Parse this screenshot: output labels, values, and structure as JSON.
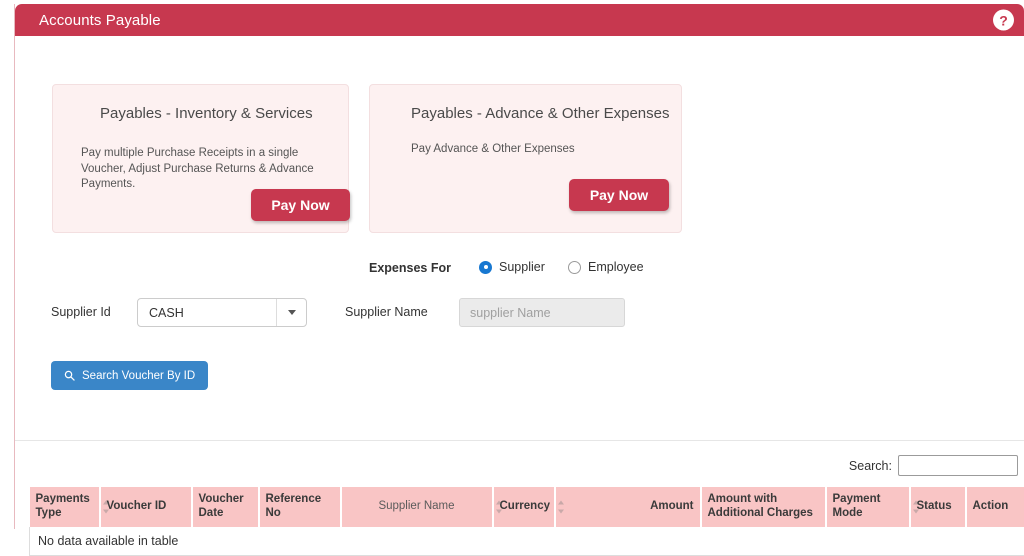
{
  "header": {
    "title": "Accounts Payable",
    "help_icon": "question-mark-icon",
    "help_label": "?",
    "bg_color": "#c7384f"
  },
  "cards": [
    {
      "title": "Payables - Inventory & Services",
      "description": "Pay multiple Purchase Receipts in a single Voucher, Adjust Purchase Returns & Advance Payments.",
      "button_label": "Pay Now"
    },
    {
      "title": "Payables - Advance & Other Expenses",
      "description": "Pay Advance & Other Expenses",
      "button_label": "Pay Now"
    }
  ],
  "form": {
    "expenses_for_label": "Expenses For",
    "radios": [
      {
        "label": "Supplier",
        "selected": true
      },
      {
        "label": "Employee",
        "selected": false
      }
    ],
    "supplier_id_label": "Supplier Id",
    "supplier_id_value": "CASH",
    "supplier_name_label": "Supplier Name",
    "supplier_name_value": "",
    "supplier_name_placeholder": "supplier Name",
    "search_voucher_button": "Search Voucher By ID"
  },
  "table": {
    "search_label": "Search:",
    "search_value": "",
    "columns": [
      {
        "label": "Payments Type",
        "align": "left",
        "bold": true,
        "sortable": false
      },
      {
        "label": "Voucher ID",
        "align": "left",
        "bold": true,
        "sortable": true
      },
      {
        "label": "Voucher Date",
        "align": "left",
        "bold": true,
        "sortable": false
      },
      {
        "label": "Reference No",
        "align": "left",
        "bold": true,
        "sortable": false
      },
      {
        "label": "Supplier Name",
        "align": "center",
        "bold": false,
        "sortable": false
      },
      {
        "label": "Currency",
        "align": "left",
        "bold": true,
        "sortable": true
      },
      {
        "label": "Amount",
        "align": "right",
        "bold": true,
        "sortable": true
      },
      {
        "label": "Amount with Additional Charges",
        "align": "left",
        "bold": true,
        "sortable": false
      },
      {
        "label": "Payment Mode",
        "align": "left",
        "bold": true,
        "sortable": false
      },
      {
        "label": "Status",
        "align": "left",
        "bold": true,
        "sortable": true
      },
      {
        "label": "Action",
        "align": "left",
        "bold": true,
        "sortable": false
      }
    ],
    "rows": [],
    "empty_message": "No data available in table",
    "header_bg": "#f9c5c5"
  }
}
